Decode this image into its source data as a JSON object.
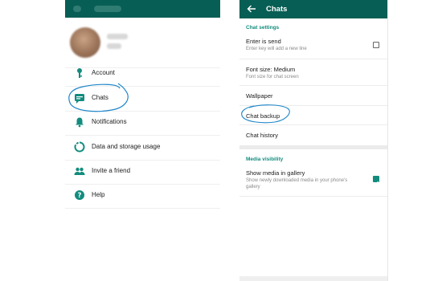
{
  "left_panel": {
    "menu": [
      {
        "label": "Account",
        "icon": "key-icon"
      },
      {
        "label": "Chats",
        "icon": "chat-icon"
      },
      {
        "label": "Notifications",
        "icon": "bell-icon"
      },
      {
        "label": "Data and storage usage",
        "icon": "data-usage-icon"
      },
      {
        "label": "Invite a friend",
        "icon": "people-icon"
      },
      {
        "label": "Help",
        "icon": "help-icon"
      }
    ]
  },
  "right_panel": {
    "title": "Chats",
    "chat_settings_header": "Chat settings",
    "enter_is_send": {
      "title": "Enter is send",
      "subtitle": "Enter key will add a new line",
      "checked": false
    },
    "font_size": {
      "title": "Font size: Medium",
      "subtitle": "Font size for chat screen"
    },
    "wallpaper": "Wallpaper",
    "chat_backup": "Chat backup",
    "chat_history": "Chat history",
    "media_visibility_header": "Media visibility",
    "show_media": {
      "title": "Show media in gallery",
      "subtitle": "Show newly downloaded media in your phone's gallery",
      "checked": true
    }
  },
  "colors": {
    "toolbar": "#075e54",
    "accent": "#128c7e",
    "annotation": "#1f86c9"
  }
}
